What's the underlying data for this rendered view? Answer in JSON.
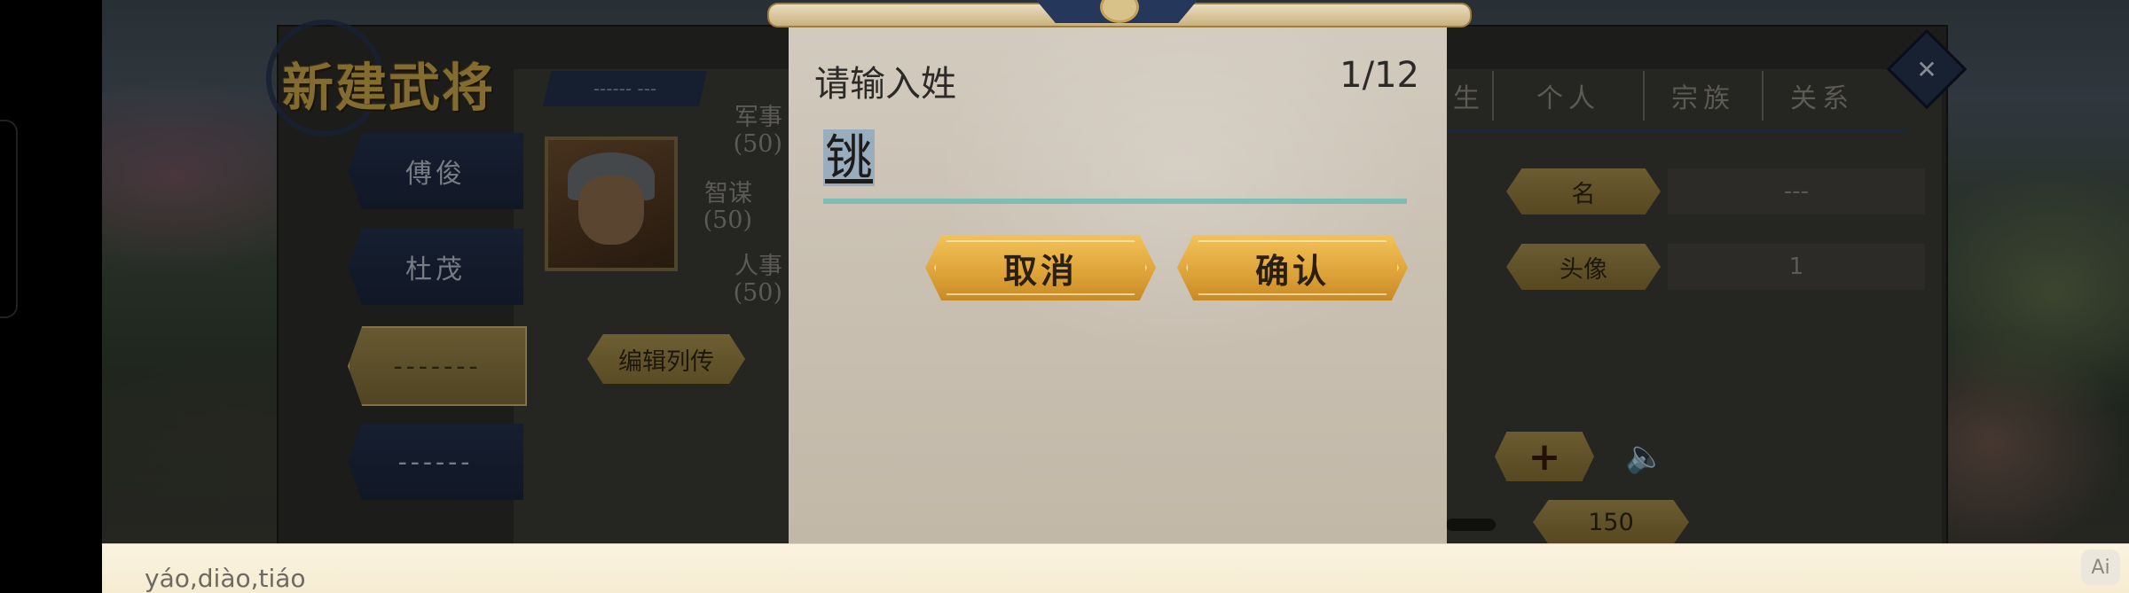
{
  "background": {
    "title": "新建武将",
    "top_strip": "------ ---",
    "general_list": [
      "傅俊",
      "杜茂",
      "-------",
      "------"
    ],
    "stats": [
      {
        "label": "军事",
        "value": "(50)"
      },
      {
        "label": "智谋",
        "value": "(50)"
      },
      {
        "label": "人事",
        "value": "(50)"
      }
    ],
    "edit_bio_label": "编辑列传",
    "right_tabs": [
      "生",
      "个人",
      "宗族",
      "关系"
    ],
    "fields": [
      {
        "label": "名",
        "value": "---"
      },
      {
        "label": "头像",
        "value": "1"
      }
    ],
    "plus_label": "+",
    "value_plate": "150",
    "close_icon": "✕"
  },
  "dialog": {
    "title": "请输入姓",
    "counter": "1/12",
    "input_value": "铫",
    "cancel_label": "取消",
    "confirm_label": "确认"
  },
  "ime": {
    "candidate": "yáo,diào,tiáo",
    "ai_label": "Ai"
  },
  "colors": {
    "dialog_bg": "#cdc5b8",
    "button_gold": "#e2a83c",
    "input_underline": "#7dbdb5",
    "selection": "#98aebf",
    "ime_bg": "#f8efd8"
  }
}
